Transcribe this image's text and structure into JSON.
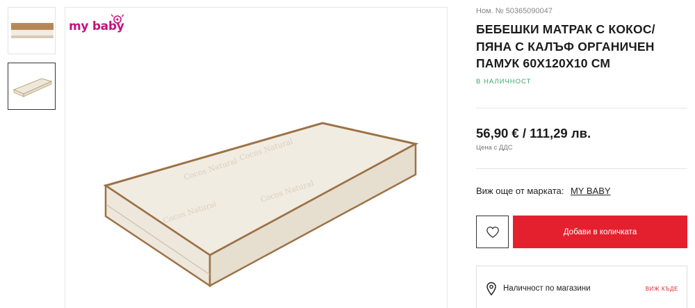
{
  "gallery": {
    "brand_logo_text": "my baby",
    "thumbnails": [
      {
        "name": "mattress-cross-section-thumb",
        "selected": false
      },
      {
        "name": "mattress-full-view-thumb",
        "selected": true
      }
    ]
  },
  "product": {
    "sku": "Ном. № 50365090047",
    "title": "БЕБЕШКИ МАТРАК С КОКОС/ ПЯНА С КАЛЪФ ОРГАНИЧЕН ПАМУК 60Х120Х10 СМ",
    "stock_status": "В НАЛИЧНОСТ",
    "price": "56,90 € / 111,29 лв.",
    "vat_note": "Цена с ДДС",
    "brand_prompt": "Виж още от марката:",
    "brand_link": "MY BABY"
  },
  "actions": {
    "wishlist_icon": "heart-icon",
    "add_to_cart": "Добави в количката"
  },
  "stores": {
    "icon": "location-pin-icon",
    "label": "Наличност по магазини",
    "see_link": "ВИЖ КЪДЕ"
  },
  "colors": {
    "accent_red": "#e4202e",
    "stock_green": "#3aa56a",
    "brand_magenta": "#c2137e"
  }
}
